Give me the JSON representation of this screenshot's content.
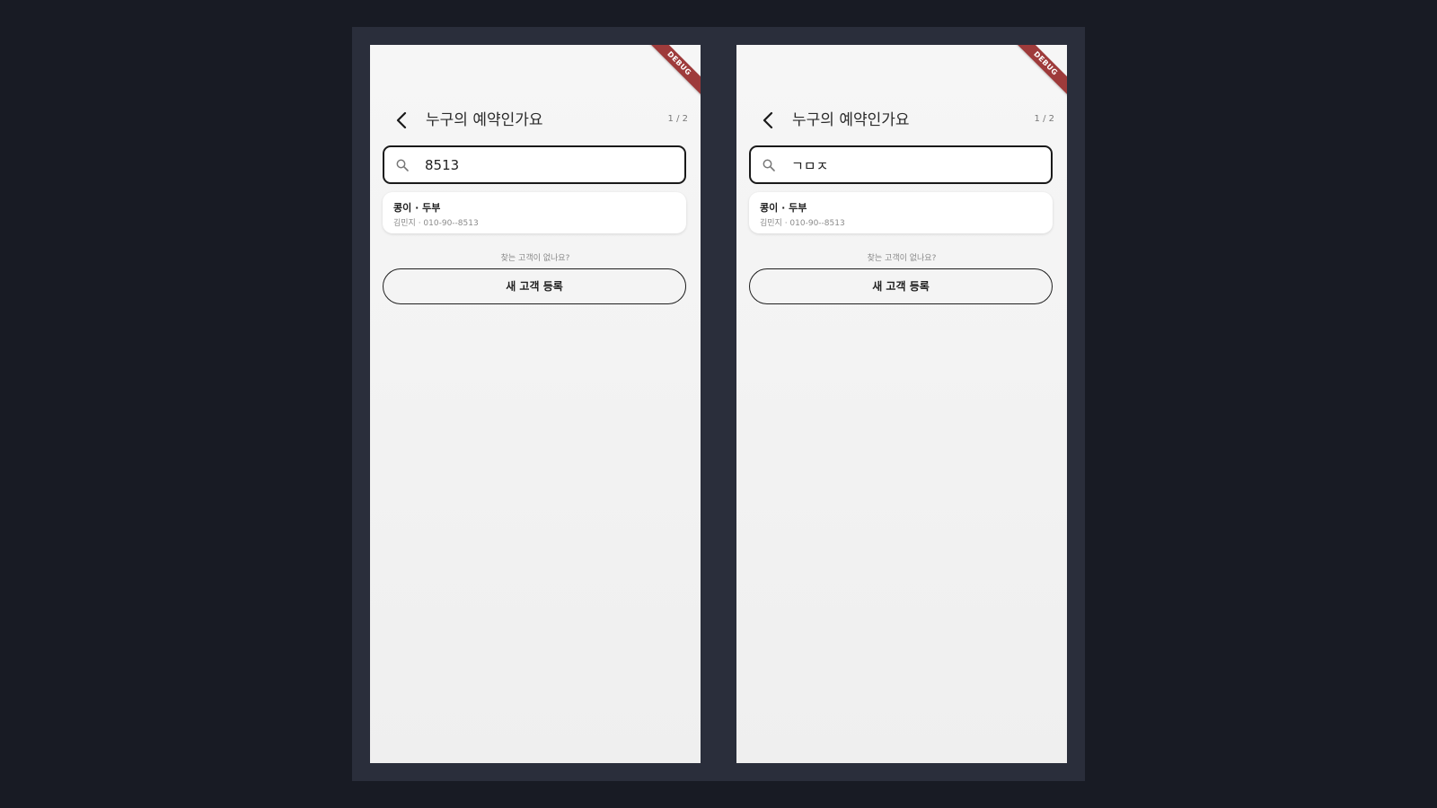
{
  "screens": [
    {
      "debug_label": "DEBUG",
      "title": "누구의 예약인가요",
      "page_indicator": "1 / 2",
      "search": {
        "value": "8513"
      },
      "result": {
        "name": "콩이 · 두부",
        "sub": "김민지 · 010-90--8513"
      },
      "hint": "찾는 고객이 없나요?",
      "register_label": "새 고객 등록"
    },
    {
      "debug_label": "DEBUG",
      "title": "누구의 예약인가요",
      "page_indicator": "1 / 2",
      "search": {
        "value": "ㄱㅁㅈ"
      },
      "result": {
        "name": "콩이 · 두부",
        "sub": "김민지 · 010-90--8513"
      },
      "hint": "찾는 고객이 없나요?",
      "register_label": "새 고객 등록"
    }
  ],
  "icons": {
    "back": "chevron-left-icon",
    "search": "search-icon"
  },
  "colors": {
    "background": "#181b24",
    "frame": "#2a2e3b",
    "screen": "#f4f4f4",
    "debug_ribbon": "#9e3b3b",
    "text_primary": "#1f1f1f",
    "text_secondary": "#8a8a8a"
  }
}
